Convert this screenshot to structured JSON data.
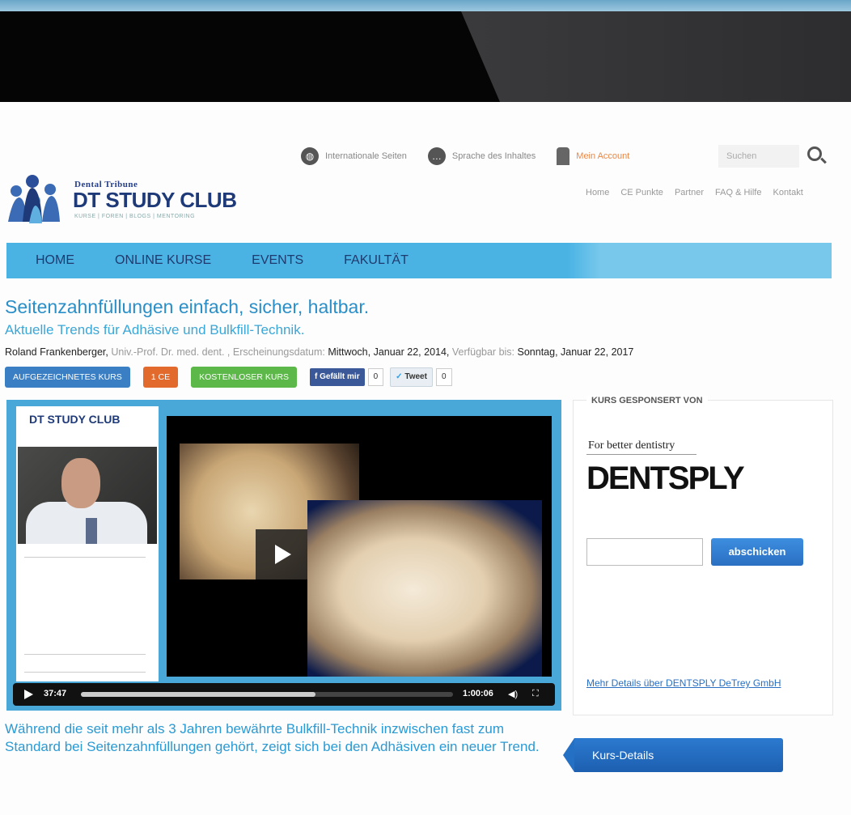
{
  "header": {
    "logo_small": "Dental Tribune",
    "logo_main": "DT STUDY CLUB",
    "logo_tagline": "KURSE | FOREN | BLOGS | MENTORING",
    "links": {
      "international": "Internationale Seiten",
      "language": "Sprache des Inhaltes",
      "account": "Mein Account",
      "search_placeholder": "Suchen"
    },
    "secondary_nav": [
      "Home",
      "CE Punkte",
      "Partner",
      "FAQ & Hilfe",
      "Kontakt"
    ]
  },
  "main_nav": [
    "HOME",
    "ONLINE KURSE",
    "EVENTS",
    "FAKULTÄT"
  ],
  "course": {
    "title": "Seitenzahnfüllungen einfach, sicher, haltbar.",
    "subtitle": "Aktuelle Trends für Adhäsive und Bulkfill-Technik.",
    "author": "Roland Frankenberger,",
    "author_title": "Univ.-Prof. Dr. med. dent. ,",
    "published_label": "Erscheinungsdatum:",
    "published": "Mittwoch, Januar 22, 2014,",
    "available_label": "Verfügbar bis:",
    "available": "Sonntag, Januar 22, 2017",
    "badges": {
      "recorded": "AUFGEZEICHNETES KURS",
      "ce": "1 CE",
      "free": "KOSTENLOSER KURS"
    },
    "social": {
      "like": "Gefällt mir",
      "like_count": "0",
      "tweet": "Tweet",
      "tweet_count": "0"
    },
    "description": "Während die seit mehr als 3 Jahren bewährte Bulkfill-Technik inzwischen fast zum Standard bei Seitenzahnfüllungen gehört, zeigt sich bei den Adhäsiven ein neuer Trend."
  },
  "player": {
    "slide_logo": "DT STUDY CLUB",
    "current_time": "37:47",
    "duration": "1:00:06",
    "progress": 0.63
  },
  "sponsor": {
    "heading": "KURS GESPONSERT VON",
    "tagline": "For better dentistry",
    "brand": "DENTSPLY",
    "submit": "abschicken",
    "more_link": "Mehr Details über DENTSPLY DeTrey GmbH"
  },
  "course_details_button": "Kurs-Details",
  "colors": {
    "nav": "#4ab3e4",
    "title": "#2a8fc8",
    "accent_blue": "#3a7fc4"
  }
}
